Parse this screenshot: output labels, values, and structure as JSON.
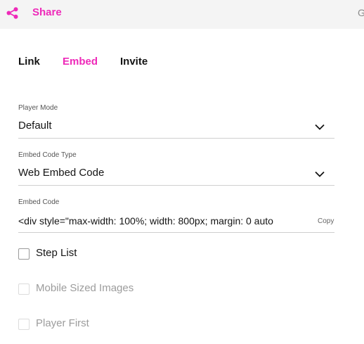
{
  "header": {
    "title": "Share",
    "icon": "share-icon",
    "accent_color": "#ee2ab9",
    "right_text": "G"
  },
  "tabs": [
    {
      "label": "Link",
      "active": false
    },
    {
      "label": "Embed",
      "active": true
    },
    {
      "label": "Invite",
      "active": false
    }
  ],
  "form": {
    "player_mode": {
      "label": "Player Mode",
      "value": "Default"
    },
    "embed_code_type": {
      "label": "Embed Code Type",
      "value": "Web Embed Code"
    },
    "embed_code": {
      "label": "Embed Code",
      "value": "<div style=\"max-width: 100%; width: 800px; margin: 0 auto",
      "copy_label": "Copy"
    }
  },
  "options": [
    {
      "label": "Step List",
      "checked": false,
      "disabled": false
    },
    {
      "label": "Mobile Sized Images",
      "checked": false,
      "disabled": true
    },
    {
      "label": "Player First",
      "checked": false,
      "disabled": true
    }
  ]
}
